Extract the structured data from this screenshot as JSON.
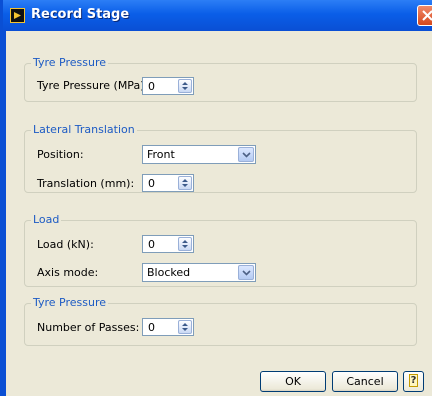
{
  "window": {
    "title": "Record Stage"
  },
  "groups": [
    {
      "title": "Tyre Pressure",
      "fields": [
        {
          "label": "Tyre Pressure (MPa):",
          "value": "0"
        }
      ]
    },
    {
      "title": "Lateral Translation",
      "fields": [
        {
          "label": "Position:",
          "value": "Front"
        },
        {
          "label": "Translation (mm):",
          "value": "0"
        }
      ]
    },
    {
      "title": "Load",
      "fields": [
        {
          "label": "Load (kN):",
          "value": "0"
        },
        {
          "label": "Axis mode:",
          "value": "Blocked"
        }
      ]
    },
    {
      "title": "Tyre Pressure",
      "fields": [
        {
          "label": "Number of Passes:",
          "value": "0"
        }
      ]
    }
  ],
  "buttons": {
    "ok": "OK",
    "cancel": "Cancel",
    "help": "?"
  },
  "icons": {
    "app": "labview-icon",
    "close": "close-icon",
    "spin": "spin-arrows-icon",
    "dropdown": "chevron-down-icon",
    "help": "help-icon"
  },
  "colors": {
    "titlebar": "#0a4fd4",
    "group_title": "#1d5bc4",
    "dialog_bg": "#ece9d8"
  }
}
